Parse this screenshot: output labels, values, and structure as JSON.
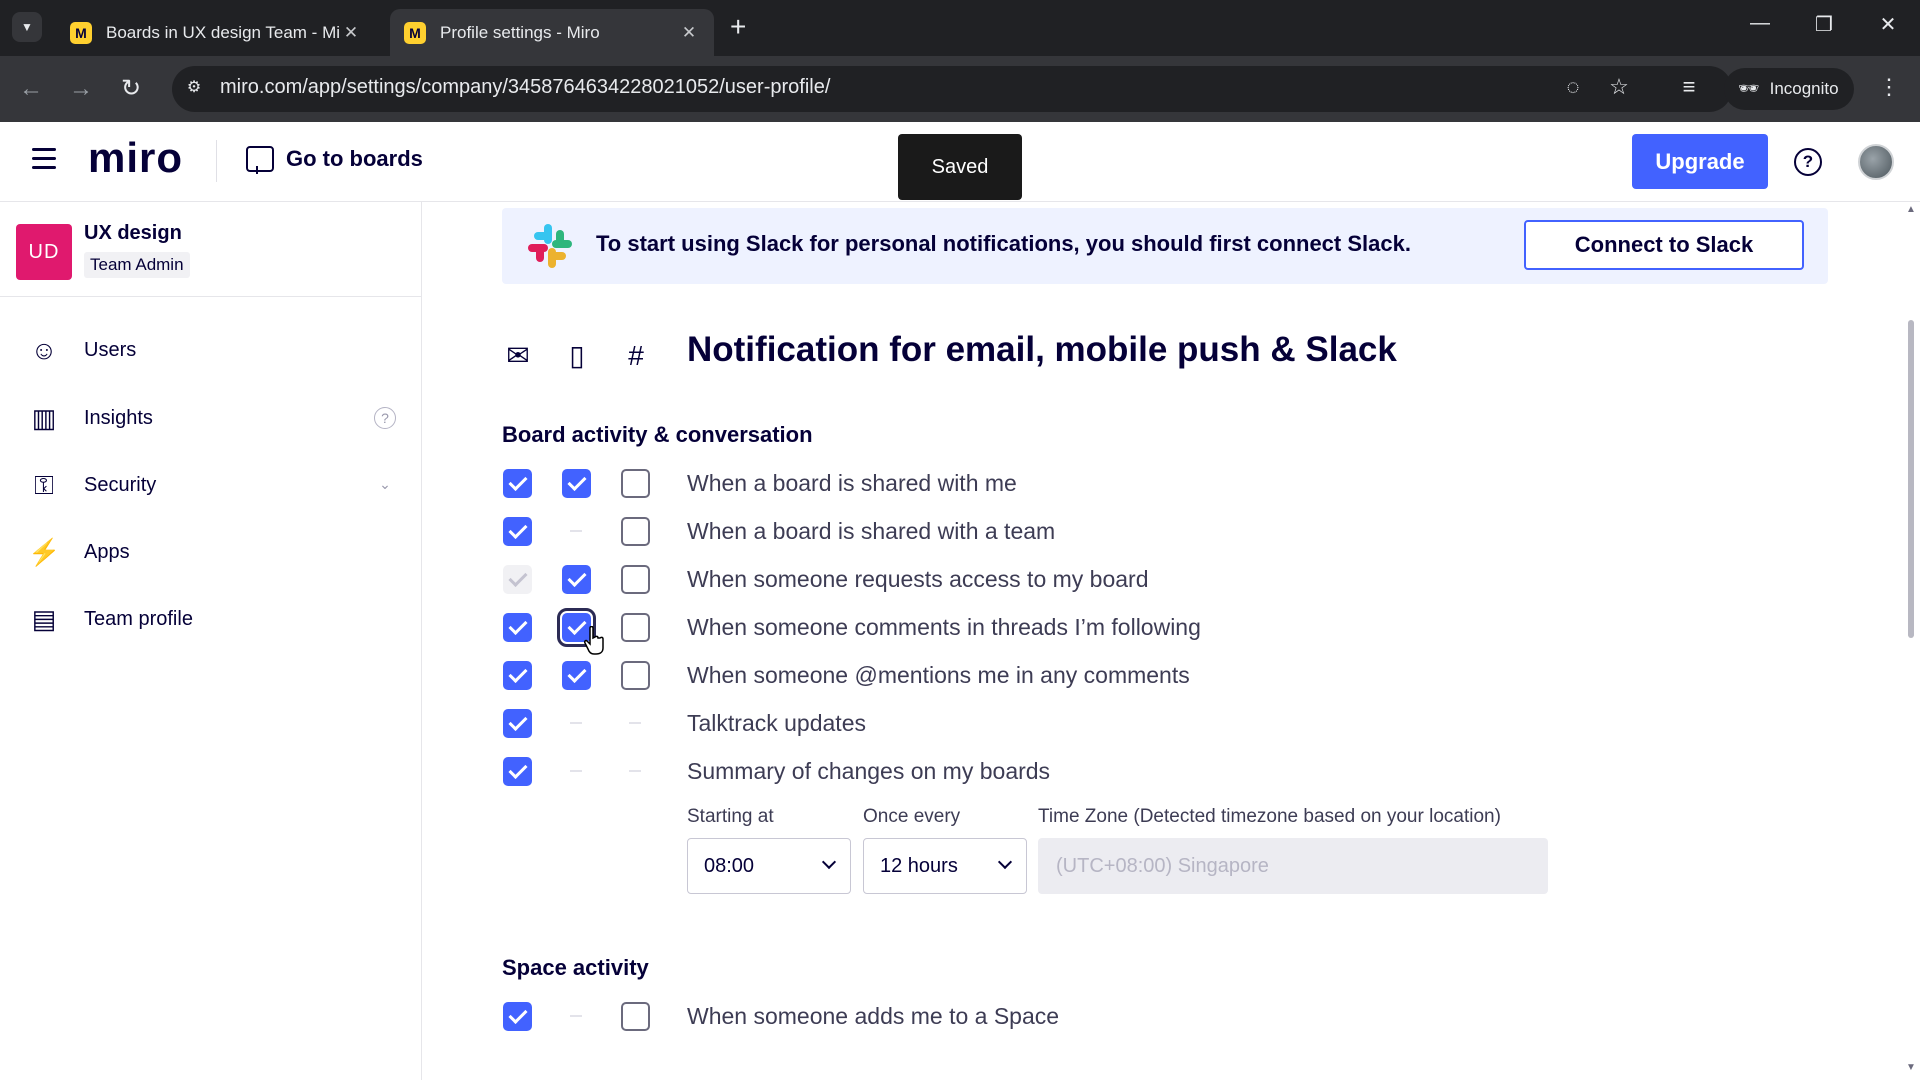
{
  "browser": {
    "tabs": [
      {
        "title": "Boards in UX design Team - Mi",
        "favicon": "M",
        "active": false
      },
      {
        "title": "Profile settings - Miro",
        "favicon": "M",
        "active": true
      }
    ],
    "url": "miro.com/app/settings/company/3458764634228021052/user-profile/",
    "incognito_label": "Incognito"
  },
  "header": {
    "logo": "miro",
    "go_to_boards": "Go to boards",
    "toast": "Saved",
    "upgrade": "Upgrade",
    "help": "?"
  },
  "sidebar": {
    "team_initials": "UD",
    "team_name": "UX design",
    "team_role": "Team Admin",
    "items": [
      {
        "label": "Users",
        "icon": "user-check-icon"
      },
      {
        "label": "Insights",
        "icon": "bar-chart-icon"
      },
      {
        "label": "Security",
        "icon": "key-icon"
      },
      {
        "label": "Apps",
        "icon": "plug-icon"
      },
      {
        "label": "Team profile",
        "icon": "layout-icon"
      }
    ],
    "insights_info": "?"
  },
  "slack_banner": {
    "text": "To start using Slack for personal notifications, you should first connect Slack.",
    "button": "Connect to Slack"
  },
  "notifications": {
    "title": "Notification for email, mobile push & Slack",
    "channels": [
      "email-icon",
      "mobile-icon",
      "slack-icon"
    ],
    "board_group": "Board activity & conversation",
    "rows": [
      {
        "label": "When a board is shared with me",
        "email": "on",
        "mobile": "on",
        "slack": "off"
      },
      {
        "label": "When a board is shared with a team",
        "email": "on",
        "mobile": "na",
        "slack": "off"
      },
      {
        "label": "When someone requests access to my board",
        "email": "disabled",
        "mobile": "on",
        "slack": "off"
      },
      {
        "label": "When someone comments in threads I’m following",
        "email": "on",
        "mobile": "on",
        "slack": "off"
      },
      {
        "label": "When someone @mentions me in any comments",
        "email": "on",
        "mobile": "on",
        "slack": "off"
      },
      {
        "label": "Talktrack updates",
        "email": "on",
        "mobile": "na",
        "slack": "na"
      },
      {
        "label": "Summary of changes on my boards",
        "email": "on",
        "mobile": "na",
        "slack": "na"
      }
    ],
    "schedule": {
      "starting_label": "Starting at",
      "starting_value": "08:00",
      "every_label": "Once every",
      "every_value": "12 hours",
      "tz_label": "Time Zone  (Detected timezone based on your location)",
      "tz_value": "(UTC+08:00) Singapore"
    },
    "space_group": "Space activity",
    "space_rows": [
      {
        "label": "When someone adds me to a Space",
        "email": "on",
        "mobile": "na",
        "slack": "off"
      }
    ]
  },
  "colors": {
    "accent": "#4262ff",
    "team_badge": "#e0196e",
    "banner_bg": "#eef2ff",
    "toast_bg": "#1a1a1a"
  }
}
